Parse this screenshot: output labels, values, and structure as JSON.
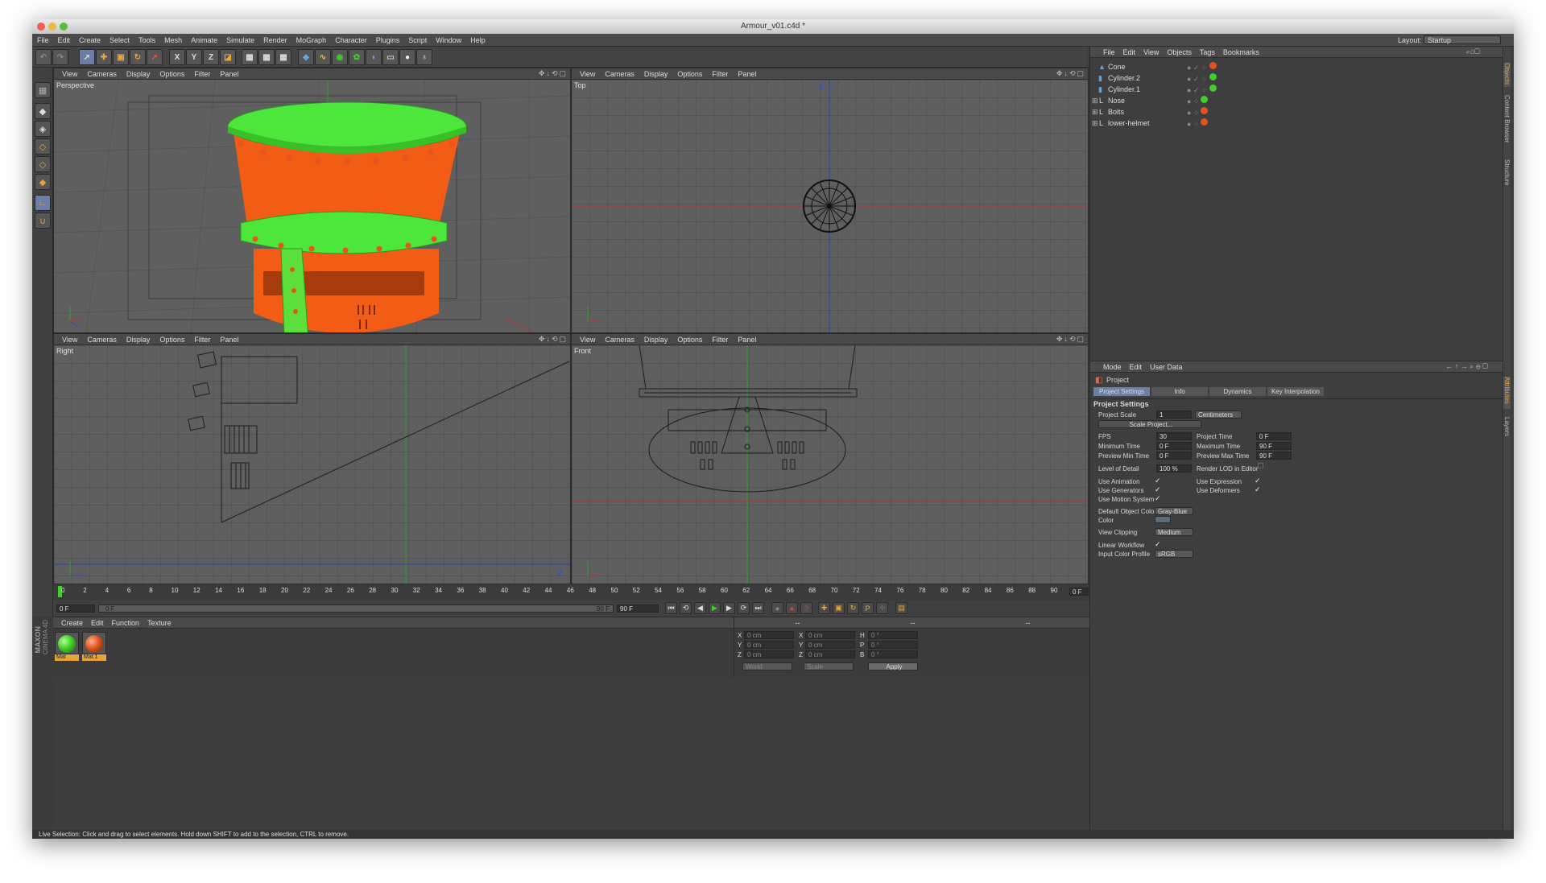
{
  "window": {
    "title": "Armour_v01.c4d *"
  },
  "menu": [
    "File",
    "Edit",
    "Create",
    "Select",
    "Tools",
    "Mesh",
    "Animate",
    "Simulate",
    "Render",
    "MoGraph",
    "Character",
    "Plugins",
    "Script",
    "Window",
    "Help"
  ],
  "layout": {
    "label": "Layout:",
    "value": "Startup"
  },
  "toolbar_glyphs": {
    "x": "X",
    "y": "Y",
    "z": "Z"
  },
  "viewport_menu": [
    "View",
    "Cameras",
    "Display",
    "Options",
    "Filter",
    "Panel"
  ],
  "viewports": {
    "perspective": "Perspective",
    "top": "Top",
    "right": "Right",
    "front": "Front"
  },
  "axis_labels": {
    "z": "Z",
    "y": "Y",
    "x": "X"
  },
  "object_manager": {
    "menu": [
      "File",
      "Edit",
      "View",
      "Objects",
      "Tags",
      "Bookmarks"
    ],
    "objects": [
      {
        "name": "Cone",
        "tag_color": "#e0531d"
      },
      {
        "name": "Cylinder.2",
        "tag_color": "#3fcf28"
      },
      {
        "name": "Cylinder.1",
        "tag_color": "#3fcf28"
      },
      {
        "name": "Nose",
        "tag_color": "#3fcf28"
      },
      {
        "name": "Bolts",
        "tag_color": "#e0531d"
      },
      {
        "name": "lower-helmet",
        "tag_color": "#e0531d"
      }
    ]
  },
  "side_tabs": {
    "top": [
      "Objects",
      "Content Browser",
      "Structure"
    ],
    "bottom": [
      "Attributes",
      "Layers"
    ]
  },
  "attributes": {
    "menu": [
      "Mode",
      "Edit",
      "User Data"
    ],
    "object": "Project",
    "tabs": [
      "Project Settings",
      "Info",
      "Dynamics",
      "Key Interpolation"
    ],
    "section": "Project Settings",
    "project_scale": {
      "label": "Project Scale",
      "value": "1",
      "unit": "Centimeters"
    },
    "scale_button": "Scale Project...",
    "fps": {
      "label": "FPS",
      "value": "30"
    },
    "project_time": {
      "label": "Project Time",
      "value": "0 F"
    },
    "min_time": {
      "label": "Minimum Time",
      "value": "0 F"
    },
    "max_time": {
      "label": "Maximum Time",
      "value": "90 F"
    },
    "preview_min": {
      "label": "Preview Min Time",
      "value": "0 F"
    },
    "preview_max": {
      "label": "Preview Max Time",
      "value": "90 F"
    },
    "lod": {
      "label": "Level of Detail",
      "value": "100 %"
    },
    "render_lod": "Render LOD in Editor",
    "use_animation": "Use Animation",
    "use_expression": "Use Expression",
    "use_generators": "Use Generators",
    "use_deformers": "Use Deformers",
    "use_motion": "Use Motion System",
    "default_color": {
      "label": "Default Object Color",
      "value": "Gray-Blue"
    },
    "color": "Color",
    "view_clipping": {
      "label": "View Clipping",
      "value": "Medium"
    },
    "linear_workflow": "Linear Workflow",
    "input_profile": {
      "label": "Input Color Profile",
      "value": "sRGB"
    }
  },
  "timeline": {
    "ticks": [
      "0",
      "2",
      "4",
      "6",
      "8",
      "10",
      "12",
      "14",
      "16",
      "18",
      "20",
      "22",
      "24",
      "26",
      "28",
      "30",
      "32",
      "34",
      "36",
      "38",
      "40",
      "42",
      "44",
      "46",
      "48",
      "50",
      "52",
      "54",
      "56",
      "58",
      "60",
      "62",
      "64",
      "66",
      "68",
      "70",
      "72",
      "74",
      "76",
      "78",
      "80",
      "82",
      "84",
      "86",
      "88",
      "90"
    ],
    "current": "0 F",
    "start": "0 F",
    "range_start": "0 F",
    "range_end": "90 F",
    "end": "90 F"
  },
  "materials": {
    "menu": [
      "Create",
      "Edit",
      "Function",
      "Texture"
    ],
    "items": [
      {
        "name": "Mat",
        "color": "#3fcf28"
      },
      {
        "name": "Mat.1",
        "color": "#e0531d"
      }
    ],
    "brand_top": "MAXON",
    "brand_bottom": "CINEMA 4D"
  },
  "coordinates": {
    "headers": [
      "--",
      "--",
      "--"
    ],
    "pos": [
      {
        "axis": "X",
        "value": "0 cm"
      },
      {
        "axis": "Y",
        "value": "0 cm"
      },
      {
        "axis": "Z",
        "value": "0 cm"
      }
    ],
    "size": [
      {
        "axis": "X",
        "value": "0 cm"
      },
      {
        "axis": "Y",
        "value": "0 cm"
      },
      {
        "axis": "Z",
        "value": "0 cm"
      }
    ],
    "rot": [
      {
        "axis": "H",
        "value": "0 °"
      },
      {
        "axis": "P",
        "value": "0 °"
      },
      {
        "axis": "B",
        "value": "0 °"
      }
    ],
    "world": "World",
    "scale": "Scale",
    "apply": "Apply"
  },
  "status": "Live Selection: Click and drag to select elements. Hold down SHIFT to add to the selection, CTRL to remove."
}
